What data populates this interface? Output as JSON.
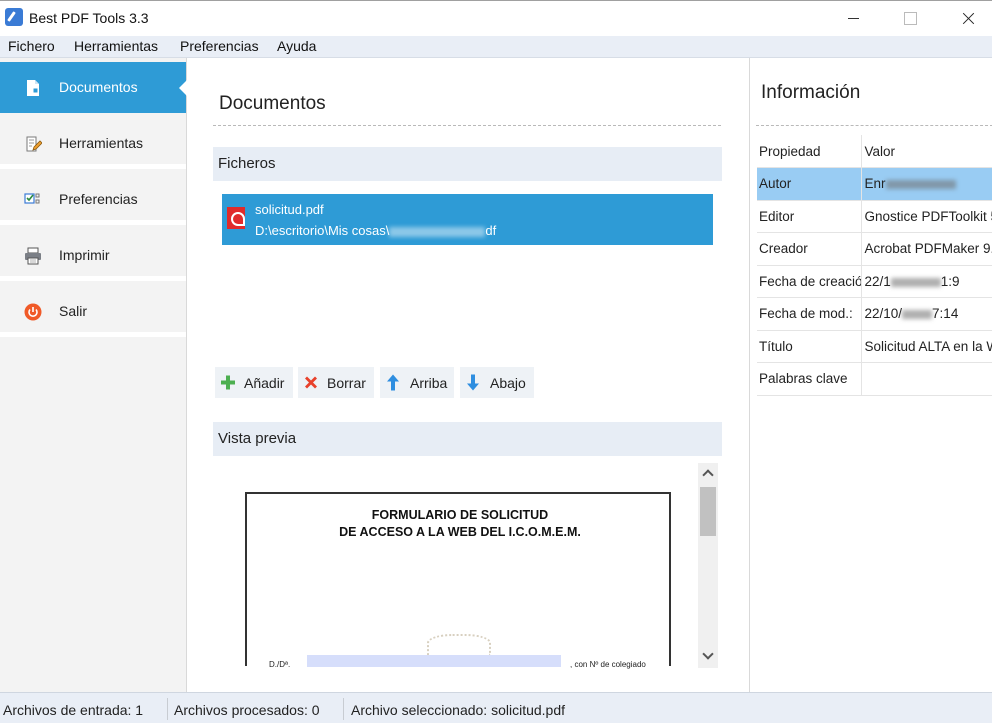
{
  "window": {
    "title": "Best PDF Tools 3.3"
  },
  "menu": {
    "items": [
      "Fichero",
      "Herramientas",
      "Preferencias",
      "Ayuda"
    ]
  },
  "sidebar": {
    "items": [
      {
        "label": "Documentos",
        "icon": "document-icon",
        "active": true
      },
      {
        "label": "Herramientas",
        "icon": "edit-icon",
        "active": false
      },
      {
        "label": "Preferencias",
        "icon": "checklist-icon",
        "active": false
      },
      {
        "label": "Imprimir",
        "icon": "printer-icon",
        "active": false
      },
      {
        "label": "Salir",
        "icon": "power-icon",
        "active": false
      }
    ]
  },
  "documents": {
    "title": "Documentos",
    "files_header": "Ficheros",
    "files": [
      {
        "name": "solicitud.pdf",
        "path": "D:\\escritorio\\Mis cosas\\",
        "path_end": "df"
      }
    ],
    "toolbar": {
      "add_label": "Añadir",
      "delete_label": "Borrar",
      "up_label": "Arriba",
      "down_label": "Abajo"
    },
    "preview_header": "Vista previa",
    "preview": {
      "line1": "FORMULARIO DE SOLICITUD",
      "line2": "DE ACCESO A LA WEB DEL I.C.O.M.E.M.",
      "field_label": "D./Dª.",
      "field_suffix": ", con Nº de colegiado"
    }
  },
  "info": {
    "title": "Información",
    "columns": [
      "Propiedad",
      "Valor"
    ],
    "rows": [
      {
        "prop": "Autor",
        "val": "Enr",
        "selected": true
      },
      {
        "prop": "Editor",
        "val": "Gnostice PDFToolkit 5",
        "selected": false
      },
      {
        "prop": "Creador",
        "val": "Acrobat PDFMaker 9.",
        "selected": false
      },
      {
        "prop": "Fecha de creació",
        "val": "22/1",
        "val_end": "1:9",
        "selected": false
      },
      {
        "prop": "Fecha de mod.:",
        "val": "22/10/",
        "val_end": "7:14",
        "selected": false
      },
      {
        "prop": "Título",
        "val": "Solicitud ALTA en la W",
        "selected": false
      },
      {
        "prop": "Palabras clave",
        "val": "",
        "selected": false
      }
    ]
  },
  "status": {
    "input_files": "Archivos de entrada: 1",
    "processed_files": "Archivos procesados: 0",
    "selected_file": "Archivo seleccionado: solicitud.pdf"
  },
  "colors": {
    "accent": "#2e9bd6",
    "selected_row": "#99ccf3",
    "header_bg": "#e7edf5"
  }
}
